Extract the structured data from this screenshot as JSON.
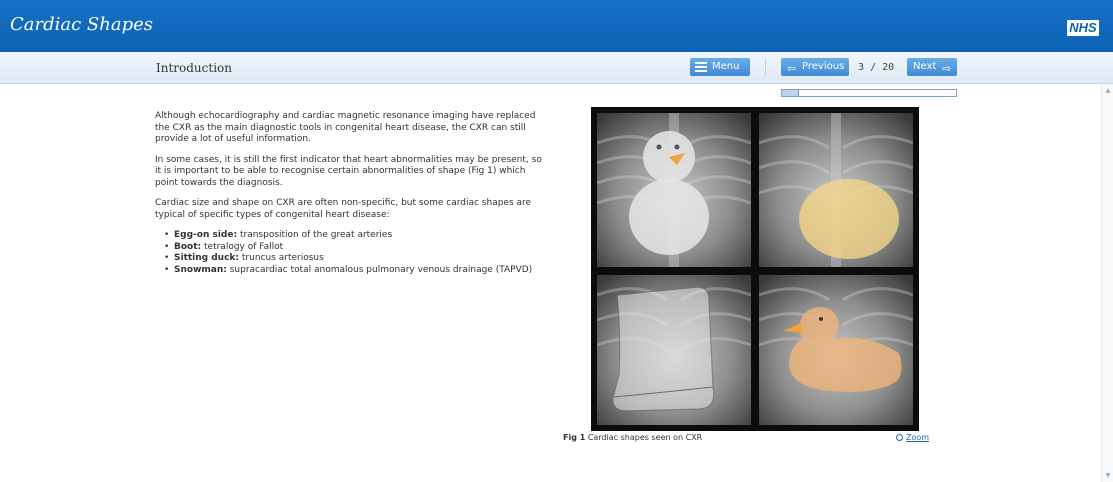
{
  "header": {
    "app_title": "Cardiac Shapes",
    "logo_text": "NHS"
  },
  "toolbar": {
    "section_title": "Introduction",
    "menu_label": "Menu",
    "prev_label": "Previous",
    "next_label": "Next",
    "page_current": "3",
    "page_separator": "/",
    "page_total": "20",
    "page_progress": 0.1
  },
  "content": {
    "paragraphs": [
      "Although echocardiography and cardiac magnetic resonance imaging have replaced the CXR as the main diagnostic tools in congenital heart disease, the CXR can still provide a lot of useful information.",
      "In some cases, it is still the first indicator that heart abnormalities may be present, so it is important to be able to recognise certain abnormalities of shape (Fig 1) which point towards the diagnosis.",
      "Cardiac size and shape on CXR are often non-specific, but some cardiac shapes are typical of specific types of congenital heart disease:"
    ],
    "list": [
      {
        "term": "Egg-on side:",
        "desc": "transposition of the great arteries"
      },
      {
        "term": "Boot:",
        "desc": "tetralogy of Fallot"
      },
      {
        "term": "Sitting duck:",
        "desc": "truncus arteriosus"
      },
      {
        "term": "Snowman:",
        "desc": "supracardiac total anomalous pulmonary venous drainage (TAPVD)"
      }
    ]
  },
  "figure": {
    "caption_label": "Fig 1",
    "caption_text": "Cardiac shapes seen on CXR",
    "zoom_label": "Zoom"
  },
  "icons": {
    "menu": "list-icon",
    "previous": "arrow-left-icon",
    "next": "arrow-right-icon",
    "zoom": "magnifier-icon"
  },
  "colors": {
    "header_blue": "#0e63b6",
    "button_blue": "#4a94db",
    "egg_overlay": "#f3d48a",
    "duck_overlay": "#efb47a",
    "duck_beak": "#f0a23c"
  }
}
